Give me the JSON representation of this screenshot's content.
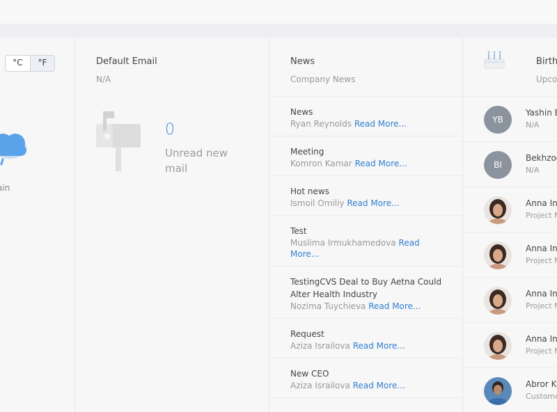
{
  "weather": {
    "unit_c": "°C",
    "unit_f": "°F",
    "condition": "ain"
  },
  "email": {
    "title": "Default Email",
    "subtitle": "N/A",
    "unread_count": "0",
    "unread_label": "Unread new mail"
  },
  "news": {
    "title": "News",
    "subtitle": "Company News",
    "read_more": "Read More...",
    "items": [
      {
        "title": "News",
        "author": "Ryan Reynolds"
      },
      {
        "title": "Meeting",
        "author": "Komron Kamar"
      },
      {
        "title": "Hot news",
        "author": "Ismoil Omiliy"
      },
      {
        "title": "Test",
        "author": "Muslima Irmukhamedova"
      },
      {
        "title": "TestingCVS Deal to Buy Aetna Could Alter Health Industry",
        "author": "Nozima Tuychieva"
      },
      {
        "title": "Request",
        "author": "Aziza Israilova"
      },
      {
        "title": "New CEO",
        "author": "Aziza Israilova"
      }
    ]
  },
  "birthdays": {
    "title": "Birthdays",
    "subtitle": "Upcoming",
    "people": [
      {
        "initials": "YB",
        "name": "Yashin B",
        "role": "N/A"
      },
      {
        "initials": "BI",
        "name": "Bekhzod I",
        "role": "N/A"
      },
      {
        "initials": "",
        "name": "Anna In",
        "role": "Project M"
      },
      {
        "initials": "",
        "name": "Anna In",
        "role": "Project M"
      },
      {
        "initials": "",
        "name": "Anna In",
        "role": "Project M"
      },
      {
        "initials": "",
        "name": "Anna In",
        "role": "Project M"
      },
      {
        "initials": "",
        "name": "Abror K",
        "role": "Customer"
      }
    ]
  },
  "colors": {
    "accent": "#3f8ad8",
    "link": "#2f7fd0",
    "avatar_gray": "#8b949e"
  }
}
